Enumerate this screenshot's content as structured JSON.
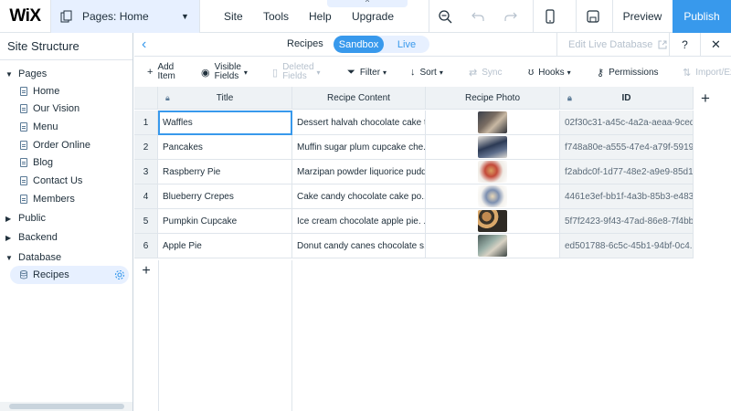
{
  "topbar": {
    "logo": "WiX",
    "pages_label": "Pages: Home",
    "menu": [
      "Site",
      "Tools",
      "Help",
      "Upgrade"
    ],
    "upgrade_tab": "^",
    "preview": "Preview",
    "publish": "Publish",
    "accent": "#3899ec"
  },
  "sidebar": {
    "title": "Site Structure",
    "groups": [
      {
        "label": "Pages",
        "expanded": true
      },
      {
        "label": "Public",
        "expanded": false
      },
      {
        "label": "Backend",
        "expanded": false
      },
      {
        "label": "Database",
        "expanded": true
      }
    ],
    "pages": [
      "Home",
      "Our Vision",
      "Menu",
      "Order Online",
      "Blog",
      "Contact Us",
      "Members"
    ],
    "collections": [
      "Recipes"
    ]
  },
  "panel": {
    "collection": "Recipes",
    "mode_on": "Sandbox",
    "mode_off": "Live",
    "edit_live": "Edit Live Database",
    "help": "?",
    "close": "✕"
  },
  "toolbar": {
    "add_item": [
      "Add",
      "Item"
    ],
    "visible_fields": [
      "Visible",
      "Fields"
    ],
    "deleted_fields": [
      "Deleted",
      "Fields"
    ],
    "filter": "Filter",
    "sort": "Sort",
    "sync": "Sync",
    "hooks": "Hooks",
    "permissions": "Permissions",
    "import_export": "Import/Ex"
  },
  "grid": {
    "columns": [
      "Title",
      "Recipe Content",
      "Recipe Photo",
      "ID"
    ],
    "rows": [
      {
        "n": "1",
        "title": "Waffles",
        "content": "Dessert halvah chocolate cake t...",
        "id": "02f30c31-a45c-4a2a-aeaa-9ced...",
        "photo": "photo-waffles"
      },
      {
        "n": "2",
        "title": "Pancakes",
        "content": "Muffin sugar plum cupcake che...",
        "id": "f748a80e-a555-47e4-a79f-5919...",
        "photo": "photo-pancakes"
      },
      {
        "n": "3",
        "title": "Raspberry Pie",
        "content": "Marzipan powder liquorice pudd...",
        "id": "f2abdc0f-1d77-48e2-a9e9-85d1...",
        "photo": "photo-raspberry-pie"
      },
      {
        "n": "4",
        "title": "Blueberry Crepes",
        "content": "Cake candy chocolate cake po...",
        "id": "4461e3ef-bb1f-4a3b-85b3-e483...",
        "photo": "photo-blueberry-crepes"
      },
      {
        "n": "5",
        "title": "Pumpkin Cupcake",
        "content": "Ice cream chocolate apple pie. ...",
        "id": "5f7f2423-9f43-47ad-86e8-7f4bb...",
        "photo": "photo-pumpkin-cupcake"
      },
      {
        "n": "6",
        "title": "Apple Pie",
        "content": "Donut candy canes chocolate s...",
        "id": "ed501788-6c5c-45b1-94bf-0c4...",
        "photo": "photo-apple-pie"
      }
    ]
  }
}
